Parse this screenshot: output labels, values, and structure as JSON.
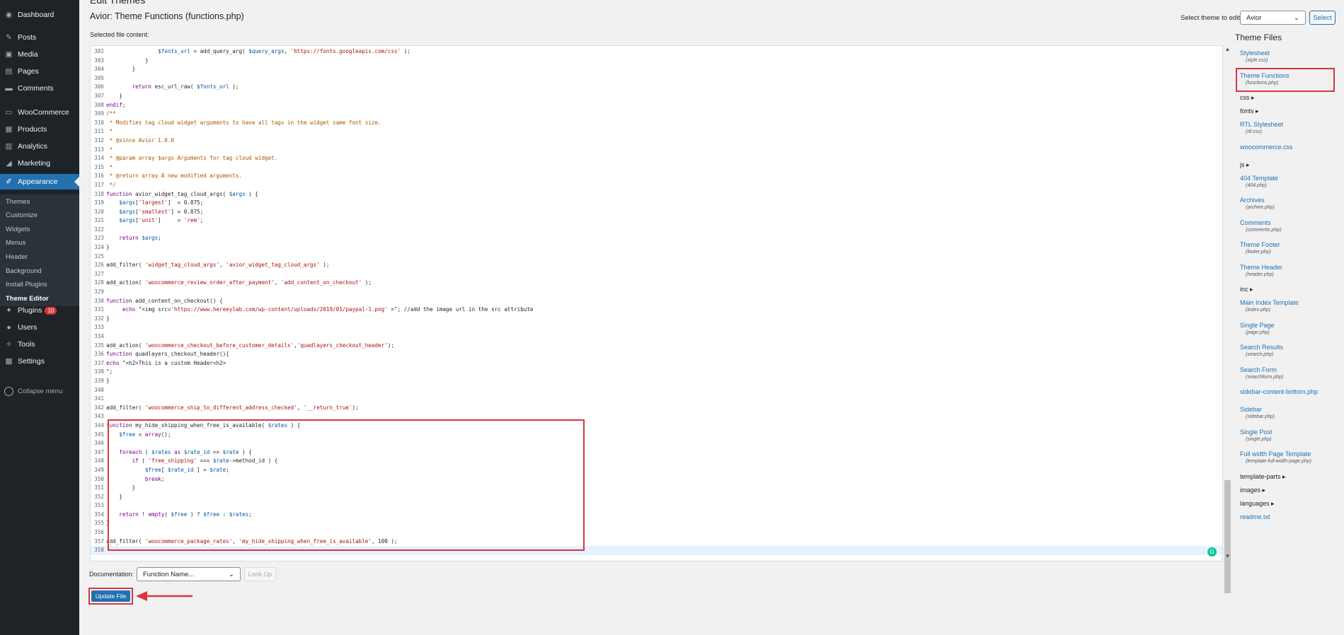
{
  "sidebar": {
    "items": [
      {
        "label": "Dashboard",
        "icon": "dashboard-icon",
        "glyph": "◉"
      },
      {
        "label": "Posts",
        "icon": "pin-icon",
        "glyph": "✎"
      },
      {
        "label": "Media",
        "icon": "media-icon",
        "glyph": "▣"
      },
      {
        "label": "Pages",
        "icon": "pages-icon",
        "glyph": "▤"
      },
      {
        "label": "Comments",
        "icon": "comments-icon",
        "glyph": "▬"
      },
      {
        "label": "WooCommerce",
        "icon": "woo-icon",
        "glyph": "▭"
      },
      {
        "label": "Products",
        "icon": "products-icon",
        "glyph": "▦"
      },
      {
        "label": "Analytics",
        "icon": "analytics-icon",
        "glyph": "▥"
      },
      {
        "label": "Marketing",
        "icon": "marketing-icon",
        "glyph": "◢"
      },
      {
        "label": "Appearance",
        "icon": "brush-icon",
        "glyph": "✐"
      },
      {
        "label": "Plugins",
        "icon": "plugins-icon",
        "glyph": "✦",
        "badge": "10"
      },
      {
        "label": "Users",
        "icon": "users-icon",
        "glyph": "●"
      },
      {
        "label": "Tools",
        "icon": "tools-icon",
        "glyph": "✧"
      },
      {
        "label": "Settings",
        "icon": "settings-icon",
        "glyph": "▩"
      }
    ],
    "submenu": [
      "Themes",
      "Customize",
      "Widgets",
      "Menus",
      "Header",
      "Background",
      "Install Plugins",
      "Theme Editor"
    ],
    "collapse": "Collapse menu"
  },
  "page": {
    "title_top": "Edit Themes",
    "title": "Avior: Theme Functions (functions.php)",
    "selected_label": "Selected file content:",
    "theme_label": "Select theme to edit:",
    "theme_value": "Avior",
    "select_button": "Select"
  },
  "editor": {
    "lines": [
      {
        "n": "302",
        "t": "                $fonts_url = add_query_arg( $query_args, 'https://fonts.googleapis.com/css' );"
      },
      {
        "n": "303",
        "t": "            }"
      },
      {
        "n": "304",
        "t": "        }"
      },
      {
        "n": "305",
        "t": ""
      },
      {
        "n": "306",
        "t": "        return esc_url_raw( $fonts_url );"
      },
      {
        "n": "307",
        "t": "    }"
      },
      {
        "n": "308",
        "t": "endif;"
      },
      {
        "n": "309",
        "t": "/**"
      },
      {
        "n": "310",
        "t": " * Modifies tag cloud widget arguments to have all tags in the widget same font size."
      },
      {
        "n": "311",
        "t": " *"
      },
      {
        "n": "312",
        "t": " * @since Avior 1.0.0"
      },
      {
        "n": "313",
        "t": " *"
      },
      {
        "n": "314",
        "t": " * @param array $args Arguments for tag cloud widget."
      },
      {
        "n": "315",
        "t": " *"
      },
      {
        "n": "316",
        "t": " * @return array A new modified arguments."
      },
      {
        "n": "317",
        "t": " */"
      },
      {
        "n": "318",
        "t": "function avior_widget_tag_cloud_args( $args ) {"
      },
      {
        "n": "319",
        "t": "    $args['largest']  = 0.875;"
      },
      {
        "n": "320",
        "t": "    $args['smallest'] = 0.875;"
      },
      {
        "n": "321",
        "t": "    $args['unit']     = 'rem';"
      },
      {
        "n": "322",
        "t": ""
      },
      {
        "n": "323",
        "t": "    return $args;"
      },
      {
        "n": "324",
        "t": "}"
      },
      {
        "n": "325",
        "t": ""
      },
      {
        "n": "326",
        "t": "add_filter( 'widget_tag_cloud_args', 'avior_widget_tag_cloud_args' );"
      },
      {
        "n": "327",
        "t": ""
      },
      {
        "n": "328",
        "t": "add_action( 'woocommerce_review_order_after_payment', 'add_content_on_checkout' );"
      },
      {
        "n": "329",
        "t": ""
      },
      {
        "n": "330",
        "t": "function add_content_on_checkout() {"
      },
      {
        "n": "331",
        "t": "     echo \"<img src='https://www.hereeylab.com/wp-content/uploads/2019/01/paypal-1.png' >\"; //add the image url in the src attribute"
      },
      {
        "n": "332",
        "t": "}"
      },
      {
        "n": "333",
        "t": ""
      },
      {
        "n": "334",
        "t": ""
      },
      {
        "n": "335",
        "t": "add_action( 'woocommerce_checkout_before_customer_details','quadlayers_checkout_header');"
      },
      {
        "n": "336",
        "t": "function quadlayers_checkout_header(){"
      },
      {
        "n": "337",
        "t": "echo \"<h2>This is a custom Header<h2>"
      },
      {
        "n": "338",
        "t": "\";"
      },
      {
        "n": "339",
        "t": "}"
      },
      {
        "n": "340",
        "t": ""
      },
      {
        "n": "341",
        "t": ""
      },
      {
        "n": "342",
        "t": "add_filter( 'woocommerce_ship_to_different_address_checked', '__return_true');"
      },
      {
        "n": "343",
        "t": ""
      },
      {
        "n": "344",
        "t": "function my_hide_shipping_when_free_is_available( $rates ) {"
      },
      {
        "n": "345",
        "t": "    $free = array();"
      },
      {
        "n": "346",
        "t": ""
      },
      {
        "n": "347",
        "t": "    foreach ( $rates as $rate_id => $rate ) {"
      },
      {
        "n": "348",
        "t": "        if ( 'free_shipping' === $rate->method_id ) {"
      },
      {
        "n": "349",
        "t": "            $free[ $rate_id ] = $rate;"
      },
      {
        "n": "350",
        "t": "            break;"
      },
      {
        "n": "351",
        "t": "        }"
      },
      {
        "n": "352",
        "t": "    }"
      },
      {
        "n": "353",
        "t": ""
      },
      {
        "n": "354",
        "t": "    return ! empty( $free ) ? $free : $rates;"
      },
      {
        "n": "355",
        "t": "}"
      },
      {
        "n": "356",
        "t": ""
      },
      {
        "n": "357",
        "t": "add_filter( 'woocommerce_package_rates', 'my_hide_shipping_when_free_is_available', 100 );"
      },
      {
        "n": "358",
        "t": ""
      }
    ]
  },
  "files": {
    "title": "Theme Files",
    "items": [
      {
        "label": "Stylesheet",
        "file": "(style.css)"
      },
      {
        "label": "Theme Functions",
        "file": "(functions.php)"
      },
      {
        "dir": "css ▸"
      },
      {
        "dir": "fonts ▸"
      },
      {
        "label": "RTL Stylesheet",
        "file": "(rtl.css)"
      },
      {
        "label": "woocommerce.css"
      },
      {
        "dir": "js ▸"
      },
      {
        "label": "404 Template",
        "file": "(404.php)"
      },
      {
        "label": "Archives",
        "file": "(archive.php)"
      },
      {
        "label": "Comments",
        "file": "(comments.php)"
      },
      {
        "label": "Theme Footer",
        "file": "(footer.php)"
      },
      {
        "label": "Theme Header",
        "file": "(header.php)"
      },
      {
        "dir": "inc ▸"
      },
      {
        "label": "Main Index Template",
        "file": "(index.php)"
      },
      {
        "label": "Single Page",
        "file": "(page.php)"
      },
      {
        "label": "Search Results",
        "file": "(search.php)"
      },
      {
        "label": "Search Form",
        "file": "(searchform.php)"
      },
      {
        "label": "sidebar-content-bottom.php"
      },
      {
        "label": "Sidebar",
        "file": "(sidebar.php)"
      },
      {
        "label": "Single Post",
        "file": "(single.php)"
      },
      {
        "label": "Full width Page Template",
        "file": "(template-full-width-page.php)"
      },
      {
        "dir": "template-parts ▸"
      },
      {
        "dir": "images ▸"
      },
      {
        "dir": "languages ▸"
      },
      {
        "label": "readme.txt"
      }
    ]
  },
  "footer": {
    "doc_label": "Documentation:",
    "doc_value": "Function Name...",
    "lookup": "Look Up",
    "update": "Update File"
  },
  "colors": {
    "accent": "#2271b1",
    "highlight": "#d7373f",
    "sidebar": "#1d2327"
  }
}
